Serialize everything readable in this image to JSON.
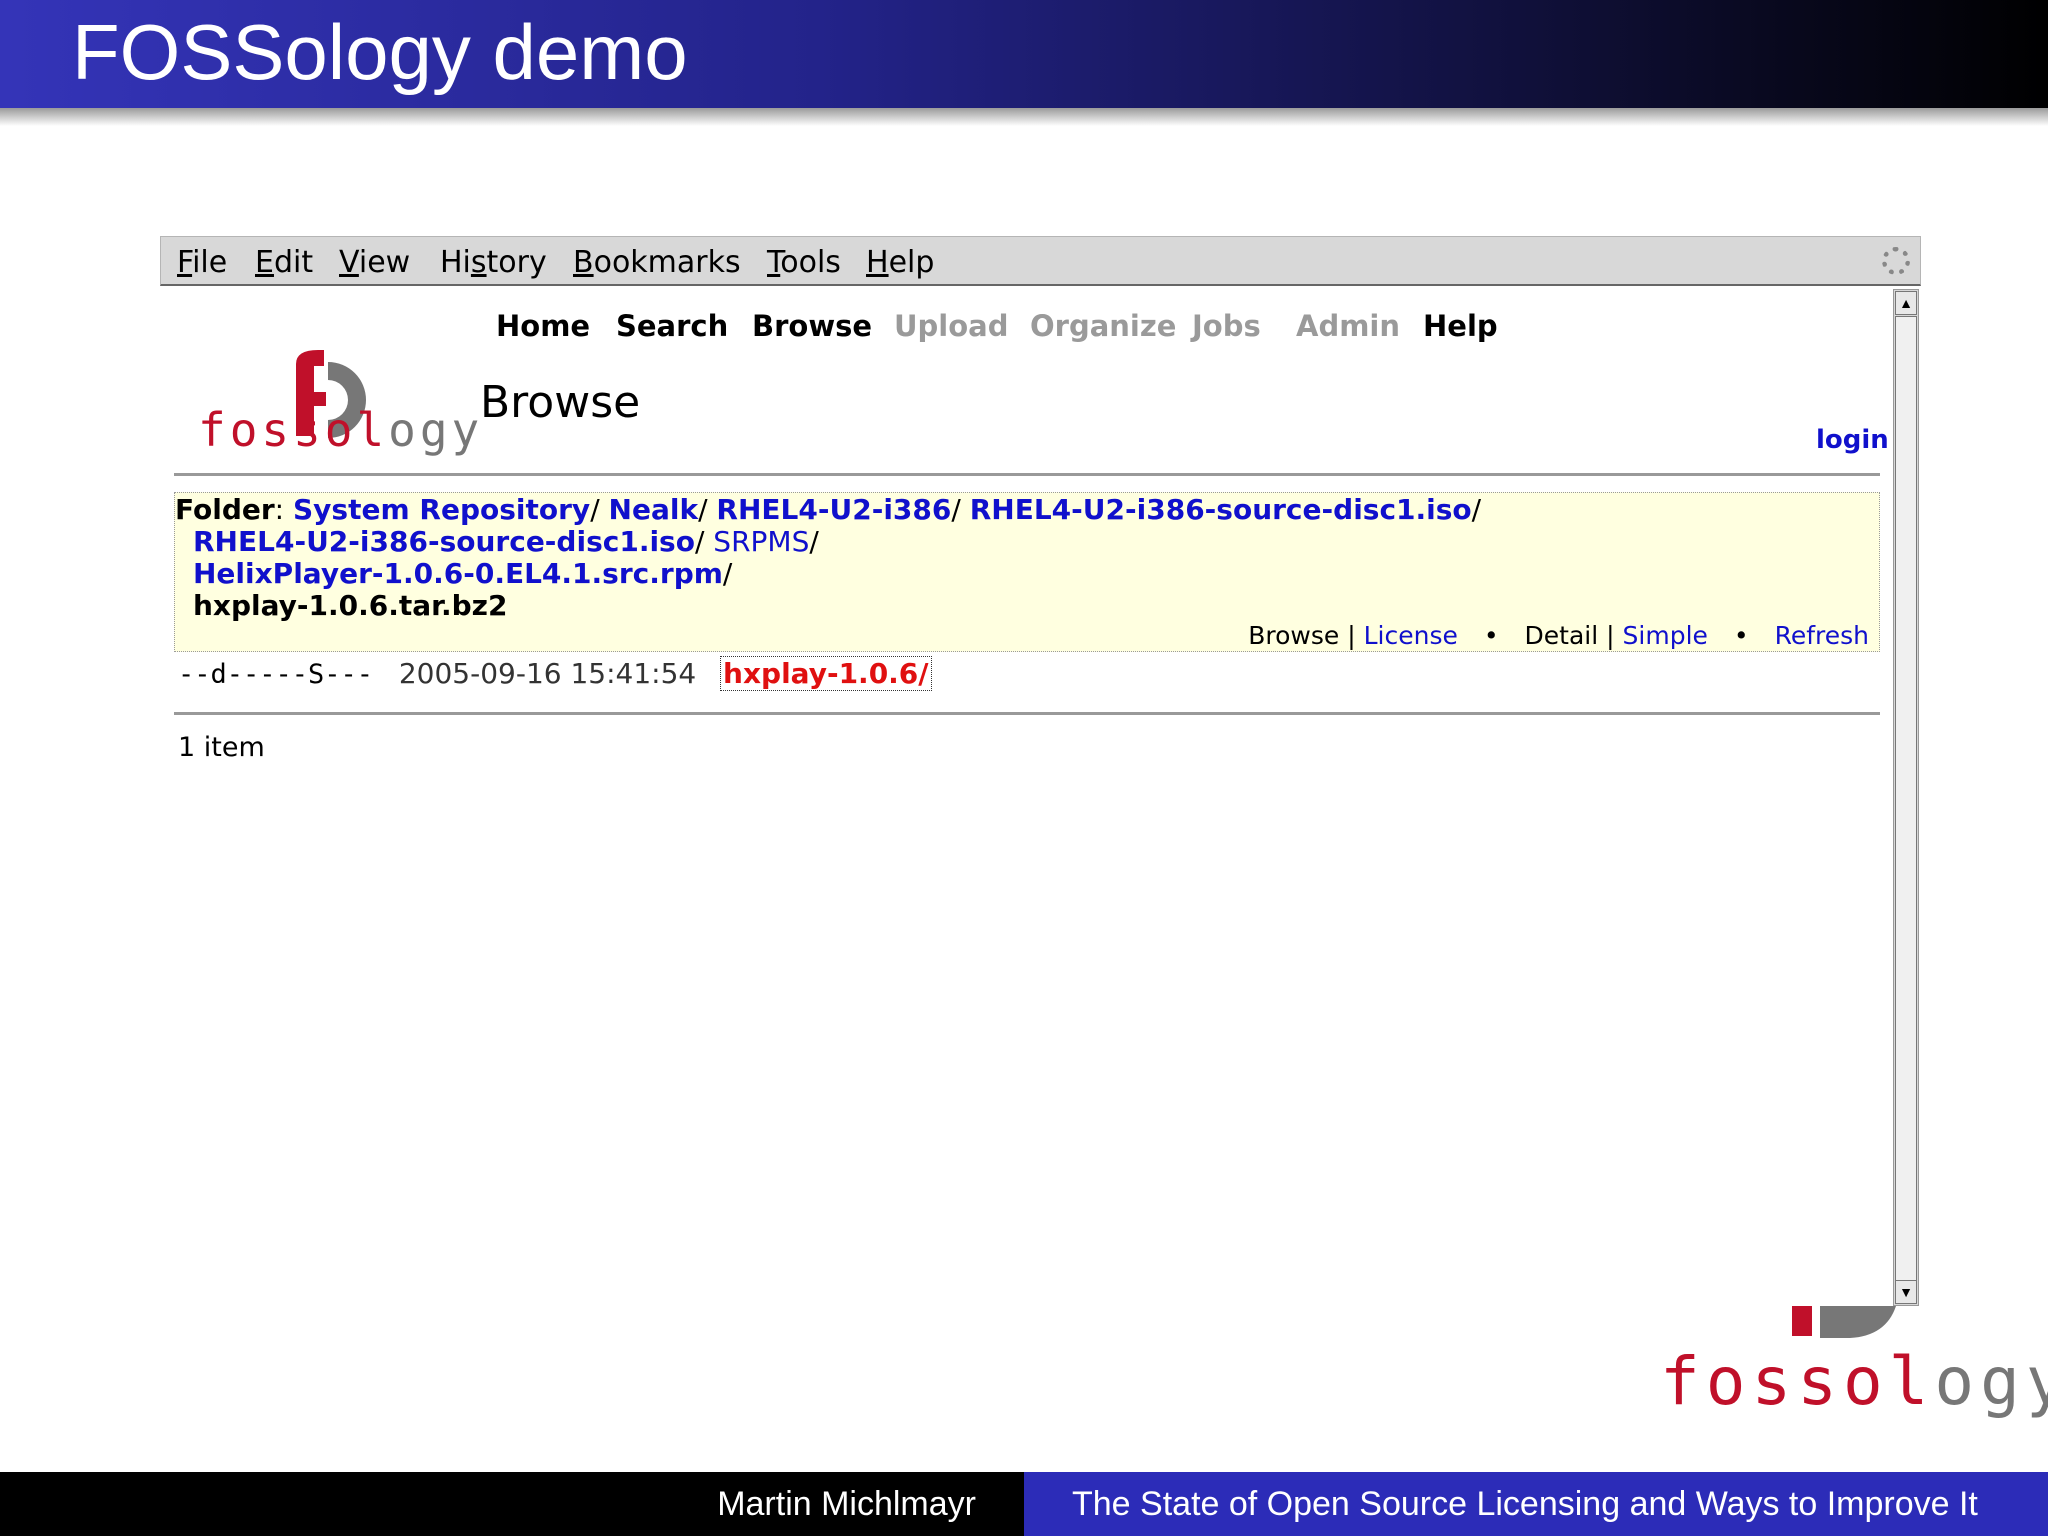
{
  "slide": {
    "title": "FOSSology demo",
    "footer_author": "Martin Michlmayr",
    "footer_title": "The State of Open Source Licensing and Ways to Improve It",
    "corner_logo_word_red": "fossol",
    "corner_logo_word_gray": "ogy"
  },
  "browser": {
    "menu": [
      {
        "hot": "F",
        "rest": "ile"
      },
      {
        "hot": "E",
        "rest": "dit"
      },
      {
        "hot": "V",
        "rest": "iew"
      },
      {
        "pre": "Hi",
        "hot": "s",
        "rest": "tory"
      },
      {
        "hot": "B",
        "rest": "ookmarks"
      },
      {
        "hot": "T",
        "rest": "ools"
      },
      {
        "hot": "H",
        "rest": "elp"
      }
    ]
  },
  "app": {
    "logo_word_red": "fossol",
    "logo_word_gray": "ogy",
    "nav": [
      {
        "label": "Home",
        "enabled": true
      },
      {
        "label": "Search",
        "enabled": true
      },
      {
        "label": "Browse",
        "enabled": true
      },
      {
        "label": "Upload",
        "enabled": false
      },
      {
        "label": "Organize",
        "enabled": false
      },
      {
        "label": "Jobs",
        "enabled": false
      },
      {
        "label": "Admin",
        "enabled": false
      },
      {
        "label": "Help",
        "enabled": true
      }
    ],
    "page_title": "Browse",
    "login": "login",
    "folder": {
      "label": "Folder",
      "path": [
        "System Repository",
        "Nealk",
        "RHEL4-U2-i386",
        "RHEL4-U2-i386-source-disc1.iso"
      ],
      "iso": "RHEL4-U2-i386-source-disc1.iso",
      "srpms": "SRPMS",
      "rpm": "HelixPlayer-1.0.6-0.EL4.1.src.rpm",
      "current": "hxplay-1.0.6.tar.bz2",
      "sep": "/"
    },
    "views": {
      "browse": "Browse",
      "license": "License",
      "detail": "Detail",
      "simple": "Simple",
      "refresh": "Refresh",
      "bar": "|",
      "dot": "•"
    },
    "entry": {
      "perms": "--d-----S---",
      "date": "2005-09-16 15:41:54",
      "name": "hxplay-1.0.6/"
    },
    "item_count": "1 item"
  }
}
